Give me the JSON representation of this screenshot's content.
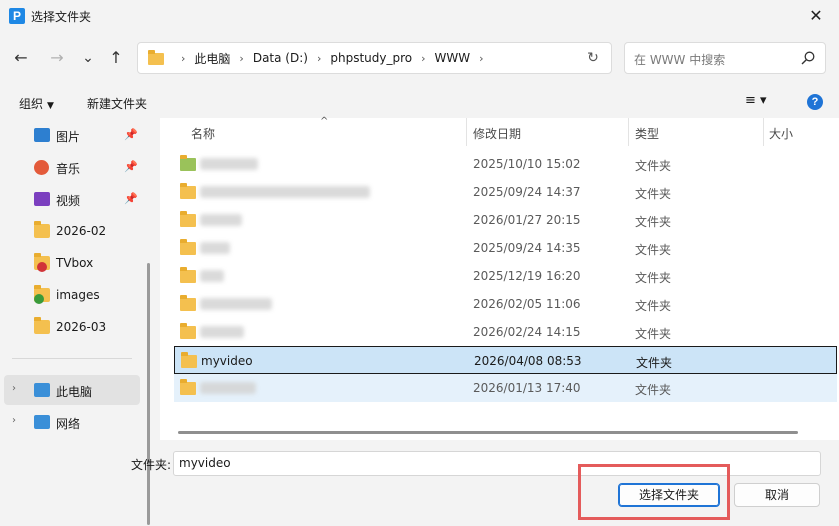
{
  "window": {
    "title": "选择文件夹",
    "app_icon_letter": "P",
    "close_glyph": "✕"
  },
  "nav": {
    "back": "←",
    "forward": "→",
    "recent": "⌄",
    "up": "↑",
    "breadcrumbs": [
      "此电脑",
      "Data (D:)",
      "phpstudy_pro",
      "WWW"
    ],
    "refresh": "↻",
    "search_placeholder": "在 WWW 中搜索"
  },
  "toolbar": {
    "organize": "组织",
    "new_folder": "新建文件夹",
    "view_glyph": "≡ ▾",
    "help": "?"
  },
  "sidebar": {
    "items": [
      {
        "label": "图片",
        "icon": "pictures-icon",
        "pinned": true
      },
      {
        "label": "音乐",
        "icon": "music-icon",
        "pinned": true
      },
      {
        "label": "视频",
        "icon": "videos-icon",
        "pinned": true
      },
      {
        "label": "2026-02",
        "icon": "folder-icon",
        "pinned": false
      },
      {
        "label": "TVbox",
        "icon": "folder-icon",
        "pinned": false
      },
      {
        "label": "images",
        "icon": "folder-icon",
        "pinned": false
      },
      {
        "label": "2026-03",
        "icon": "folder-icon",
        "pinned": false
      }
    ],
    "tree": [
      {
        "label": "此电脑",
        "selected": true
      },
      {
        "label": "网络",
        "selected": false
      }
    ],
    "pin_glyph": "📌",
    "expand_glyph": "›"
  },
  "filelist": {
    "headers": {
      "name": "名称",
      "date": "修改日期",
      "type": "类型",
      "size": "大小"
    },
    "rows": [
      {
        "name": "",
        "date": "2025/10/10 15:02",
        "type": "文件夹"
      },
      {
        "name": "",
        "date": "2025/09/24 14:37",
        "type": "文件夹"
      },
      {
        "name": "",
        "date": "2026/01/27 20:15",
        "type": "文件夹"
      },
      {
        "name": "",
        "date": "2025/09/24 14:35",
        "type": "文件夹"
      },
      {
        "name": "",
        "date": "2025/12/19 16:20",
        "type": "文件夹"
      },
      {
        "name": "",
        "date": "2026/02/05 11:06",
        "type": "文件夹"
      },
      {
        "name": "",
        "date": "2026/02/24 14:15",
        "type": "文件夹"
      },
      {
        "name": "myvideo",
        "date": "2026/04/08 08:53",
        "type": "文件夹"
      },
      {
        "name": "",
        "date": "2026/01/13 17:40",
        "type": "文件夹"
      }
    ]
  },
  "bottom": {
    "folder_label": "文件夹:",
    "folder_value": "myvideo",
    "select_button": "选择文件夹",
    "cancel_button": "取消"
  },
  "colors": {
    "accent": "#1f74d6",
    "selection": "#cce4f7",
    "highlight": "#e45b5b",
    "folder": "#f4c04f"
  }
}
